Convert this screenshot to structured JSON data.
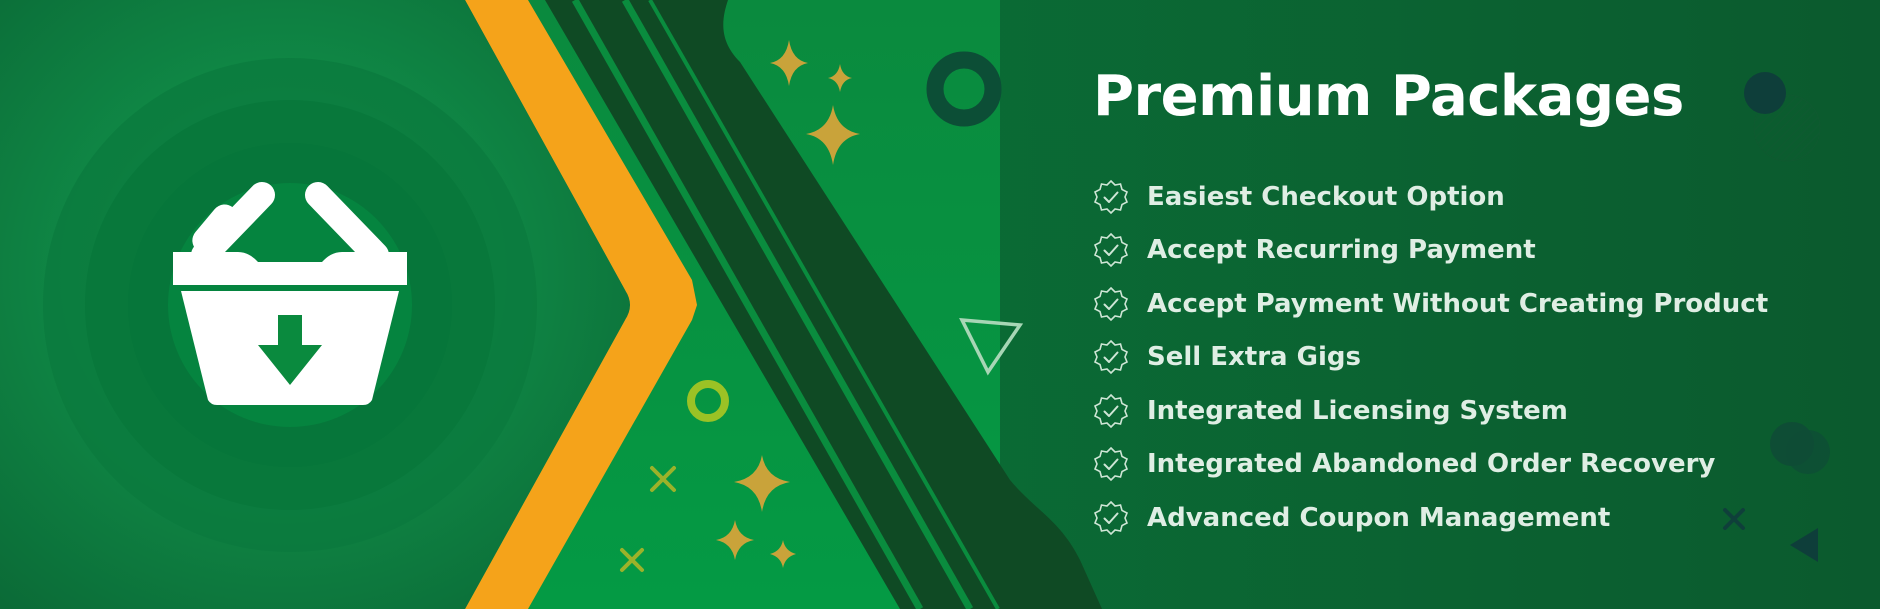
{
  "banner": {
    "title": "Premium Packages",
    "features": [
      {
        "label": "Easiest Checkout Option",
        "icon": "check-badge-icon"
      },
      {
        "label": "Accept Recurring Payment",
        "icon": "check-badge-icon"
      },
      {
        "label": "Accept Payment Without Creating Product",
        "icon": "check-badge-icon"
      },
      {
        "label": "Sell Extra Gigs",
        "icon": "check-badge-icon"
      },
      {
        "label": "Integrated Licensing System",
        "icon": "check-badge-icon"
      },
      {
        "label": "Integrated Abandoned Order Recovery",
        "icon": "check-badge-icon"
      },
      {
        "label": "Advanced Coupon Management",
        "icon": "check-badge-icon"
      }
    ],
    "logo_icon": "shopping-basket-download-icon",
    "colors": {
      "background": "#0b6e3a",
      "accent_orange": "#f5a31a",
      "dark_stripe": "#0f4a24",
      "sparkle_gold": "#c9a33a",
      "text": "#ffffff"
    }
  }
}
